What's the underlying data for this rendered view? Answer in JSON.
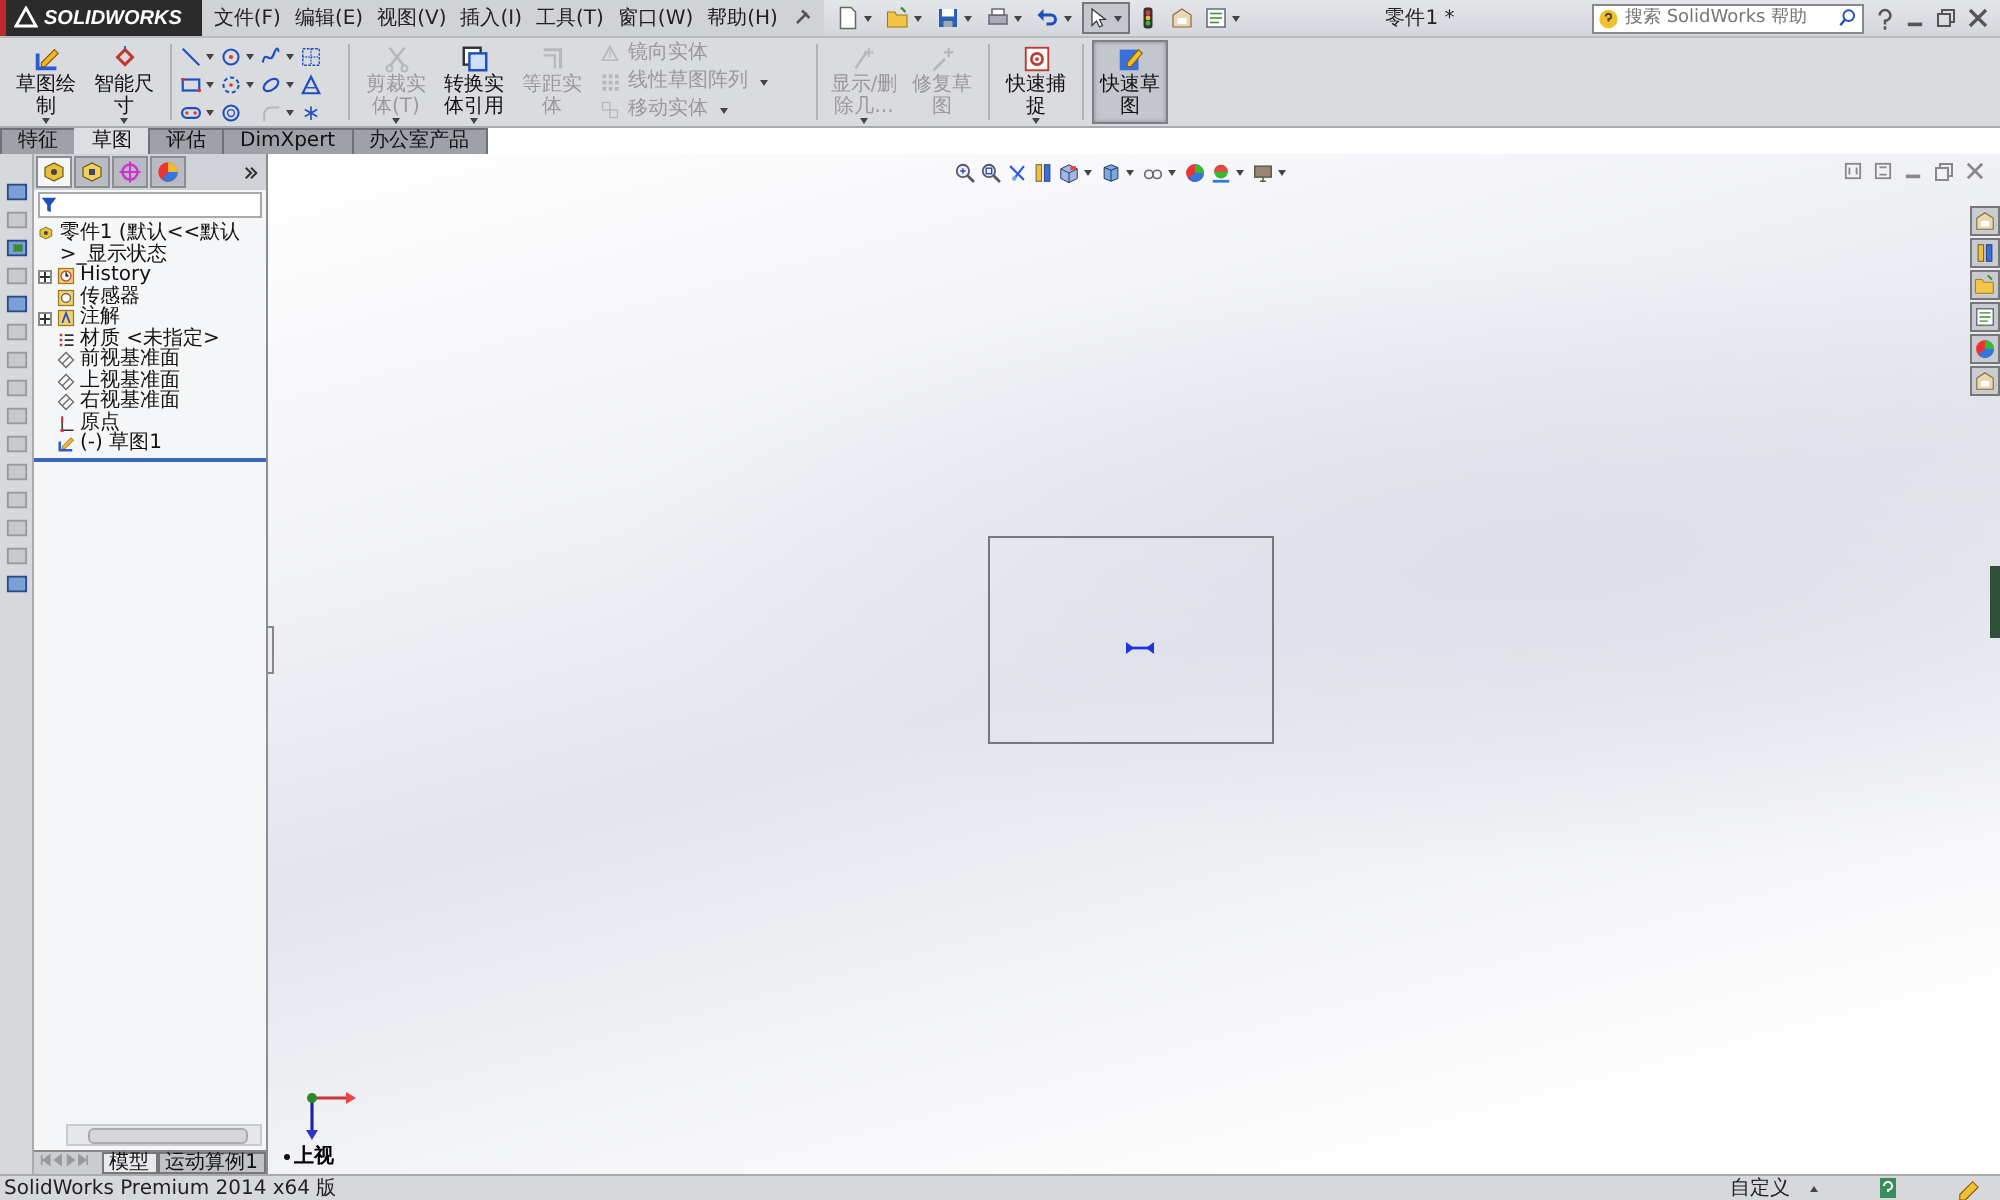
{
  "app": {
    "logo_text": "SOLIDWORKS"
  },
  "menu": [
    {
      "label": "文件(F)"
    },
    {
      "label": "编辑(E)"
    },
    {
      "label": "视图(V)"
    },
    {
      "label": "插入(I)"
    },
    {
      "label": "工具(T)"
    },
    {
      "label": "窗口(W)"
    },
    {
      "label": "帮助(H)"
    }
  ],
  "quick_access": [
    {
      "kind": "new",
      "has_menu": true,
      "selected": false
    },
    {
      "kind": "open",
      "has_menu": true,
      "selected": false
    },
    {
      "kind": "save",
      "has_menu": true,
      "selected": false
    },
    {
      "kind": "print",
      "has_menu": true,
      "selected": false
    },
    {
      "kind": "undo",
      "has_menu": true,
      "selected": false
    },
    {
      "kind": "select",
      "has_menu": true,
      "selected": true
    },
    {
      "kind": "rebuild",
      "has_menu": false,
      "selected": false
    },
    {
      "kind": "properties",
      "has_menu": false,
      "selected": false
    },
    {
      "kind": "options",
      "has_menu": true,
      "selected": false
    }
  ],
  "window": {
    "title": "零件1 *"
  },
  "search": {
    "placeholder": "搜索 SolidWorks 帮助"
  },
  "ribbon": {
    "groups": [
      {
        "items": [
          {
            "kind": "large",
            "label": "草图绘制",
            "has_menu": true,
            "disabled": false,
            "selected": false
          },
          {
            "kind": "large",
            "label": "智能尺寸",
            "has_menu": true,
            "disabled": false,
            "selected": false
          }
        ]
      },
      {
        "items": [
          {
            "kind": "grid",
            "tools": [
              {
                "kind": "line",
                "has_menu": true,
                "disabled": false
              },
              {
                "kind": "circle",
                "has_menu": true,
                "disabled": false
              },
              {
                "kind": "spline",
                "has_menu": true,
                "disabled": false
              },
              {
                "kind": "grid",
                "has_menu": false,
                "disabled": false
              },
              {
                "kind": "rect",
                "has_menu": true,
                "disabled": false
              },
              {
                "kind": "arc",
                "has_menu": true,
                "disabled": false
              },
              {
                "kind": "ellipse",
                "has_menu": true,
                "disabled": false
              },
              {
                "kind": "text",
                "has_menu": false,
                "disabled": false
              },
              {
                "kind": "slot",
                "has_menu": true,
                "disabled": false
              },
              {
                "kind": "polygon",
                "has_menu": false,
                "disabled": false
              },
              {
                "kind": "fillet",
                "has_menu": true,
                "disabled": true
              },
              {
                "kind": "point",
                "has_menu": false,
                "disabled": false
              }
            ]
          }
        ]
      },
      {
        "items": [
          {
            "kind": "large",
            "label": "剪裁实体(T)",
            "has_menu": true,
            "disabled": true,
            "selected": false
          },
          {
            "kind": "large",
            "label": "转换实体引用",
            "has_menu": true,
            "disabled": false,
            "selected": false
          },
          {
            "kind": "large",
            "label": "等距实体",
            "has_menu": false,
            "disabled": true,
            "selected": false
          },
          {
            "kind": "list",
            "entries": [
              {
                "kind": "mirror",
                "label": "镜向实体",
                "has_menu": false,
                "disabled": true
              },
              {
                "kind": "pattern",
                "label": "线性草图阵列",
                "has_menu": true,
                "disabled": true
              },
              {
                "kind": "move",
                "label": "移动实体",
                "has_menu": true,
                "disabled": true
              }
            ]
          }
        ]
      },
      {
        "items": [
          {
            "kind": "large",
            "label": "显示/删除几...",
            "has_menu": true,
            "disabled": true,
            "selected": false
          },
          {
            "kind": "large",
            "label": "修复草图",
            "has_menu": false,
            "disabled": true,
            "selected": false
          }
        ]
      },
      {
        "items": [
          {
            "kind": "large",
            "label": "快速捕捉",
            "has_menu": true,
            "disabled": false,
            "selected": false
          }
        ]
      },
      {
        "items": [
          {
            "kind": "large",
            "label": "快速草图",
            "has_menu": false,
            "disabled": false,
            "selected": true
          }
        ]
      }
    ]
  },
  "command_tabs": [
    {
      "label": "特征",
      "selected": false
    },
    {
      "label": "草图",
      "selected": true
    },
    {
      "label": "评估",
      "selected": false
    },
    {
      "label": "DimXpert",
      "selected": false
    },
    {
      "label": "办公室产品",
      "selected": false
    }
  ],
  "panel_tabs": [
    {
      "kind": "tree",
      "selected": true
    },
    {
      "kind": "property",
      "selected": false
    },
    {
      "kind": "config",
      "selected": false
    },
    {
      "kind": "display",
      "selected": false
    }
  ],
  "tree": {
    "label": "零件1  (默认<<默认>_显示状态",
    "children": [
      {
        "kind": "history",
        "label": "History",
        "expandable": true
      },
      {
        "kind": "sensor",
        "label": "传感器",
        "expandable": false
      },
      {
        "kind": "annotation",
        "label": "注解",
        "expandable": true
      },
      {
        "kind": "material",
        "label": "材质 <未指定>",
        "expandable": false
      },
      {
        "kind": "plane",
        "label": "前视基准面",
        "expandable": false
      },
      {
        "kind": "plane",
        "label": "上视基准面",
        "expandable": false
      },
      {
        "kind": "plane",
        "label": "右视基准面",
        "expandable": false
      },
      {
        "kind": "origin",
        "label": "原点",
        "expandable": false
      },
      {
        "kind": "sketch",
        "label": "(-) 草图1",
        "expandable": false
      }
    ]
  },
  "view_toolbar": [
    {
      "kind": "zoom-fit",
      "has_menu": false
    },
    {
      "kind": "zoom-area",
      "has_menu": false
    },
    {
      "kind": "previous-view",
      "has_menu": false
    },
    {
      "kind": "section-view",
      "has_menu": false
    },
    {
      "kind": "view-orientation",
      "has_menu": true
    },
    {
      "kind": "display-style",
      "has_menu": true
    },
    {
      "kind": "hide-show",
      "has_menu": true
    },
    {
      "kind": "appearance",
      "has_menu": false
    },
    {
      "kind": "scene",
      "has_menu": true
    },
    {
      "kind": "display-settings",
      "has_menu": true
    }
  ],
  "viewport": {
    "view_label": "上视"
  },
  "bottom_tabs": [
    {
      "label": "模型",
      "selected": true
    },
    {
      "label": "运动算例1",
      "selected": false
    }
  ],
  "status_bar": {
    "text": "SolidWorks Premium 2014 x64 版",
    "units": "自定义"
  }
}
